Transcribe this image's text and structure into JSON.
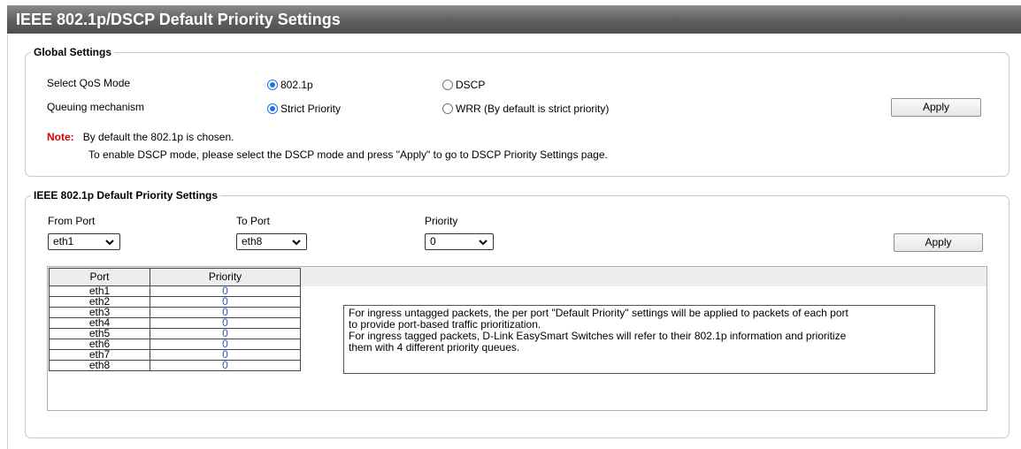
{
  "page": {
    "title": "IEEE 802.1p/DSCP Default Priority Settings"
  },
  "global_settings": {
    "legend": "Global Settings",
    "qos_mode_label": "Select QoS Mode",
    "qos_options": [
      "802.1p",
      "DSCP"
    ],
    "qos_selected": "802.1p",
    "queuing_label": "Queuing mechanism",
    "queuing_options": [
      "Strict Priority",
      "WRR (By default is strict priority)"
    ],
    "queuing_selected": "Strict Priority",
    "apply_label": "Apply",
    "note_label": "Note:",
    "note_line1": "By default the 802.1p is chosen.",
    "note_line2": "To enable DSCP mode, please select the DSCP mode and press \"Apply\" to go to DSCP Priority Settings page."
  },
  "default_priority": {
    "legend": "IEEE 802.1p Default Priority Settings",
    "from_port_label": "From Port",
    "from_port_value": "eth1",
    "to_port_label": "To Port",
    "to_port_value": "eth8",
    "priority_label": "Priority",
    "priority_value": "0",
    "apply_label": "Apply",
    "table_headers": [
      "Port",
      "Priority"
    ],
    "rows": [
      {
        "port": "eth1",
        "priority": "0"
      },
      {
        "port": "eth2",
        "priority": "0"
      },
      {
        "port": "eth3",
        "priority": "0"
      },
      {
        "port": "eth4",
        "priority": "0"
      },
      {
        "port": "eth5",
        "priority": "0"
      },
      {
        "port": "eth6",
        "priority": "0"
      },
      {
        "port": "eth7",
        "priority": "0"
      },
      {
        "port": "eth8",
        "priority": "0"
      }
    ],
    "description_lines": [
      "For ingress untagged packets, the per port \"Default Priority\" settings will be applied to packets of each port",
      "to provide port-based traffic prioritization.",
      "For ingress tagged packets, D-Link EasySmart Switches will refer to their 802.1p information and prioritize",
      "them with 4 different priority queues."
    ]
  },
  "colors": {
    "title_bar": "#5e5e5e",
    "note_red": "#d40000",
    "priority_value_blue": "#2b57b5",
    "radio_accent": "#1a73e8"
  }
}
